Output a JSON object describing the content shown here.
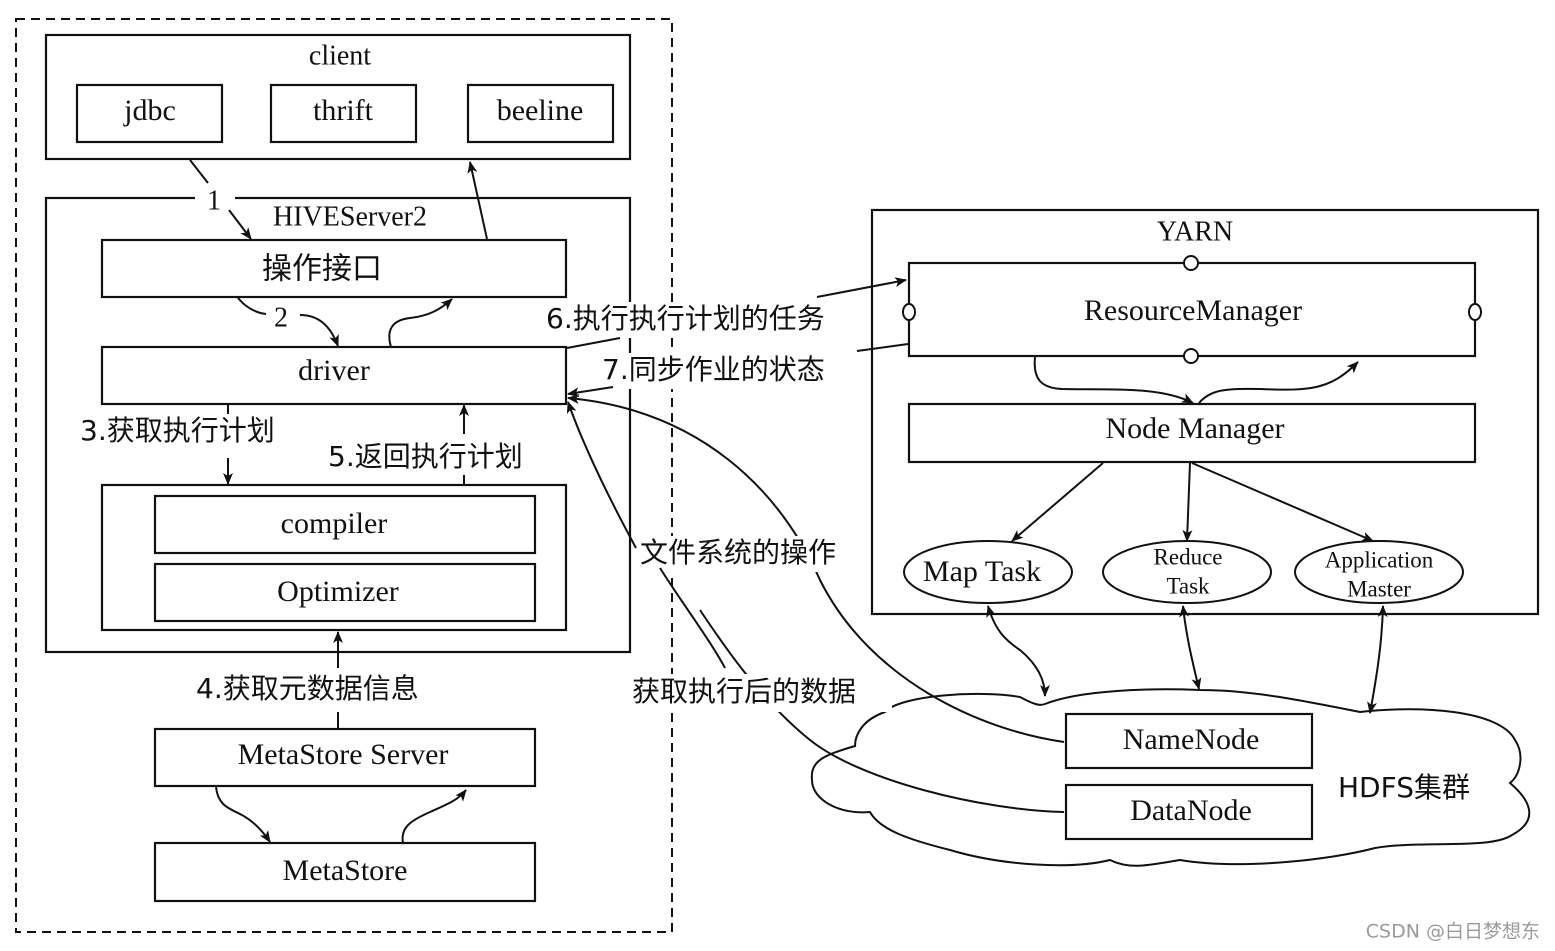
{
  "hive_side": {
    "client": {
      "title": "client",
      "items": [
        "jdbc",
        "thrift",
        "beeline"
      ]
    },
    "hiveserver2": {
      "title": "HIVEServer2",
      "interface": "操作接口",
      "driver": "driver",
      "compiler": "compiler",
      "optimizer": "Optimizer"
    },
    "metastore_server": "MetaStore Server",
    "metastore": "MetaStore"
  },
  "steps": {
    "s1": "1",
    "s2": "2",
    "s3": "3.获取执行计划",
    "s4": "4.获取元数据信息",
    "s5": "5.返回执行计划",
    "s6": "6.执行执行计划的任务",
    "s7": "7.同步作业的状态",
    "fs_ops": "文件系统的操作",
    "fetch_result": "获取执行后的数据"
  },
  "yarn": {
    "title": "YARN",
    "resource_manager": "ResourceManager",
    "node_manager": "Node Manager",
    "tasks": [
      {
        "line1": "Map Task",
        "line2": ""
      },
      {
        "line1": "Reduce",
        "line2": "Task"
      },
      {
        "line1": "Application",
        "line2": "Master"
      }
    ]
  },
  "hdfs": {
    "title": "HDFS集群",
    "namenode": "NameNode",
    "datanode": "DataNode"
  },
  "watermark": "CSDN @白日梦想东"
}
